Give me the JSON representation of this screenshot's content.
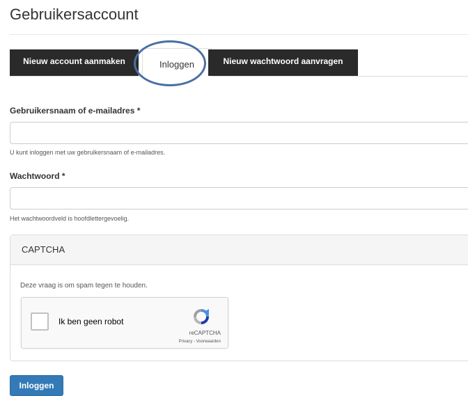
{
  "page": {
    "title": "Gebruikersaccount"
  },
  "tabs": [
    {
      "label": "Nieuw account aanmaken",
      "active": false
    },
    {
      "label": "Inloggen",
      "active": true
    },
    {
      "label": "Nieuw wachtwoord aanvragen",
      "active": false
    }
  ],
  "form": {
    "username": {
      "label": "Gebruikersnaam of e-mailadres *",
      "value": "",
      "placeholder": "",
      "help": "U kunt inloggen met uw gebruikersnaam of e-mailadres."
    },
    "password": {
      "label": "Wachtwoord *",
      "value": "",
      "placeholder": "",
      "help": "Het wachtwoordveld is hoofdlettergevoelig."
    },
    "captcha": {
      "title": "CAPTCHA",
      "description": "Deze vraag is om spam tegen te houden.",
      "checkbox_label": "Ik ben geen robot",
      "brand": "reCAPTCHA",
      "terms": "Privacy - Voorwaarden"
    },
    "submit_label": "Inloggen"
  },
  "colors": {
    "tab_dark": "#2a2a2a",
    "primary_button": "#337ab7",
    "highlight_ring": "#4a6fa5"
  }
}
